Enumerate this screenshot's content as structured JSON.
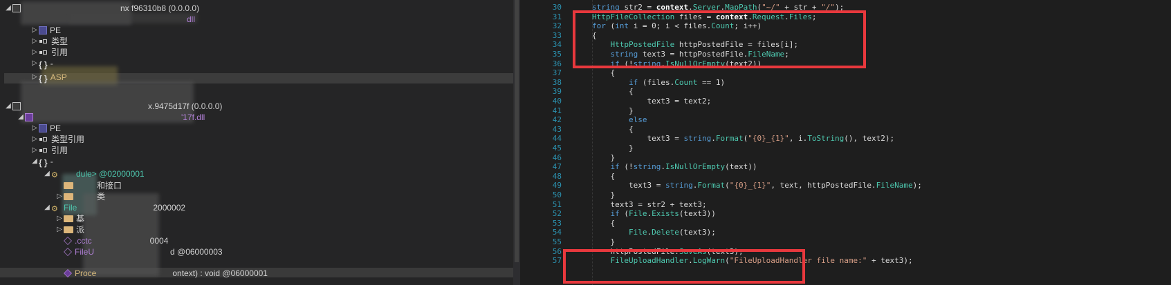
{
  "tree": {
    "nodes": [
      {
        "label": "nx f96310b8 (0.0.0.0)",
        "cls": "lbl-meta"
      },
      {
        "label": "dll",
        "cls": "lbl-purple"
      },
      {
        "label": "PE",
        "cls": "lbl-meta"
      },
      {
        "label": "类型",
        "cls": "lbl-meta"
      },
      {
        "label": "引用",
        "cls": "lbl-meta"
      },
      {
        "label": "-",
        "cls": "lbl-meta"
      },
      {
        "label": "ASP",
        "cls": "lbl-orange"
      },
      {
        "label": "x.9475d17f (0.0.0.0)",
        "cls": "lbl-meta"
      },
      {
        "label": "'17f.dll",
        "cls": "lbl-purple"
      },
      {
        "label": "PE",
        "cls": "lbl-meta"
      },
      {
        "label": "类型引用",
        "cls": "lbl-meta"
      },
      {
        "label": "引用",
        "cls": "lbl-meta"
      },
      {
        "label": "-",
        "cls": "lbl-meta"
      },
      {
        "label": "dule> @02000001",
        "cls": "lbl-class"
      },
      {
        "label": "和接口",
        "cls": "lbl-meta"
      },
      {
        "label": "类",
        "cls": "lbl-meta"
      },
      {
        "label": "File",
        "cls": "lbl-class"
      },
      {
        "label": "2000002",
        "cls": "lbl-meta"
      },
      {
        "label": "基",
        "cls": "lbl-meta"
      },
      {
        "label": "派",
        "cls": "lbl-meta"
      },
      {
        "label": ".cctc",
        "cls": "lbl-purple"
      },
      {
        "label": "0004",
        "cls": "lbl-meta"
      },
      {
        "label": "FileU",
        "cls": "lbl-purple"
      },
      {
        "label": "d @06000003",
        "cls": "lbl-meta"
      },
      {
        "label": "Proce",
        "cls": "lbl-orange"
      },
      {
        "label": "ontext) : void @06000001",
        "cls": "lbl-meta"
      }
    ]
  },
  "code": {
    "lines": [
      {
        "n": "30",
        "t": "string str2 = context.Server.MapPath(\"~/\" + str + \"/\");"
      },
      {
        "n": "31",
        "t": "HttpFileCollection files = context.Request.Files;"
      },
      {
        "n": "32",
        "t": "for (int i = 0; i < files.Count; i++)"
      },
      {
        "n": "33",
        "t": "{"
      },
      {
        "n": "34",
        "t": "    HttpPostedFile httpPostedFile = files[i];"
      },
      {
        "n": "35",
        "t": "    string text3 = httpPostedFile.FileName;"
      },
      {
        "n": "36",
        "t": "    if (!string.IsNullOrEmpty(text2))"
      },
      {
        "n": "37",
        "t": "    {"
      },
      {
        "n": "38",
        "t": "        if (files.Count == 1)"
      },
      {
        "n": "39",
        "t": "        {"
      },
      {
        "n": "40",
        "t": "            text3 = text2;"
      },
      {
        "n": "41",
        "t": "        }"
      },
      {
        "n": "42",
        "t": "        else"
      },
      {
        "n": "43",
        "t": "        {"
      },
      {
        "n": "44",
        "t": "            text3 = string.Format(\"{0}_{1}\", i.ToString(), text2);"
      },
      {
        "n": "45",
        "t": "        }"
      },
      {
        "n": "46",
        "t": "    }"
      },
      {
        "n": "47",
        "t": "    if (!string.IsNullOrEmpty(text))"
      },
      {
        "n": "48",
        "t": "    {"
      },
      {
        "n": "49",
        "t": "        text3 = string.Format(\"{0}_{1}\", text, httpPostedFile.FileName);"
      },
      {
        "n": "50",
        "t": "    }"
      },
      {
        "n": "51",
        "t": "    text3 = str2 + text3;"
      },
      {
        "n": "52",
        "t": "    if (File.Exists(text3))"
      },
      {
        "n": "53",
        "t": "    {"
      },
      {
        "n": "54",
        "t": "        File.Delete(text3);"
      },
      {
        "n": "55",
        "t": "    }"
      },
      {
        "n": "56",
        "t": "    httpPostedFile.SaveAs(text3);"
      },
      {
        "n": "57",
        "t": "    FileUploadHandler.LogWarn(\"FileUploadHandler file name:\" + text3);"
      }
    ]
  },
  "colors": {
    "highlight": "#e8383d",
    "line_number": "#2b91af",
    "keyword": "#569cd6",
    "type": "#4ec9b0",
    "string": "#d69d85"
  }
}
